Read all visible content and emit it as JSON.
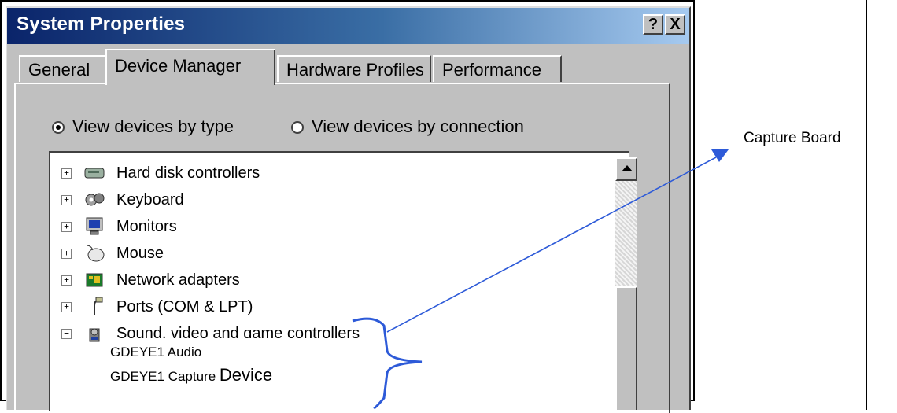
{
  "window": {
    "title": "System Properties",
    "help_button": "?",
    "close_button": "X"
  },
  "tabs": [
    {
      "label": "General",
      "active": false
    },
    {
      "label": "Device Manager",
      "active": true
    },
    {
      "label": "Hardware Profiles",
      "active": false
    },
    {
      "label": "Performance",
      "active": false
    }
  ],
  "view_options": {
    "by_type": "View devices by type",
    "by_connection": "View devices by connection",
    "selected": "by_type"
  },
  "devices": [
    {
      "label": "Hard disk controllers",
      "expander": "+",
      "icon": "disk-controller-icon"
    },
    {
      "label": "Keyboard",
      "expander": "+",
      "icon": "keyboard-icon"
    },
    {
      "label": "Monitors",
      "expander": "+",
      "icon": "monitor-icon"
    },
    {
      "label": "Mouse",
      "expander": "+",
      "icon": "mouse-icon"
    },
    {
      "label": "Network adapters",
      "expander": "+",
      "icon": "network-adapter-icon"
    },
    {
      "label": "Ports (COM & LPT)",
      "expander": "+",
      "icon": "port-icon"
    },
    {
      "label": "Sound, video and game controllers",
      "expander": "−",
      "icon": "sound-icon"
    }
  ],
  "callout": {
    "line1": "GDEYE1 Audio",
    "line2_prefix": "GDEYE1 Capture",
    "line2_suffix": "Device"
  },
  "annotation": {
    "label": "Capture Board",
    "color": "#3366dd"
  }
}
